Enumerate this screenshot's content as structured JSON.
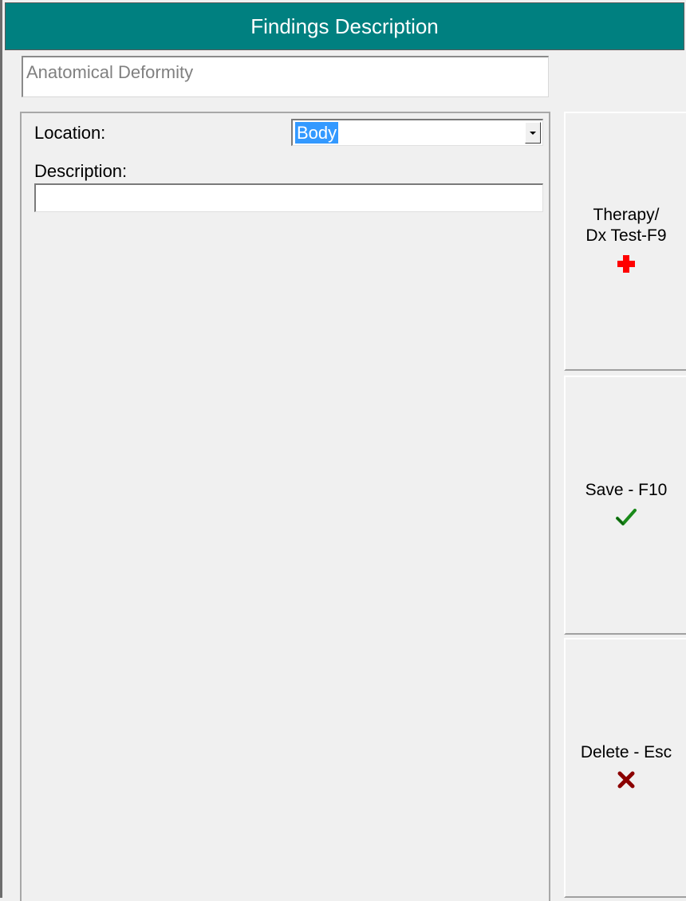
{
  "window": {
    "title": "Findings Description"
  },
  "category": {
    "value": "Anatomical Deformity"
  },
  "form": {
    "location_label": "Location:",
    "location_value": "Body",
    "description_label": "Description:",
    "description_value": ""
  },
  "buttons": {
    "therapy_label": "Therapy/\nDx Test-F9",
    "save_label": "Save - F10",
    "delete_label": "Delete - Esc"
  },
  "icons": {
    "therapy": "red-cross-icon",
    "save": "green-checkmark-icon",
    "delete": "dark-red-x-icon"
  },
  "colors": {
    "title_bar": "#008080",
    "selection": "#3399ff",
    "plus": "#ff0000",
    "check": "#1a8a1a",
    "delete_x": "#8b0000"
  }
}
